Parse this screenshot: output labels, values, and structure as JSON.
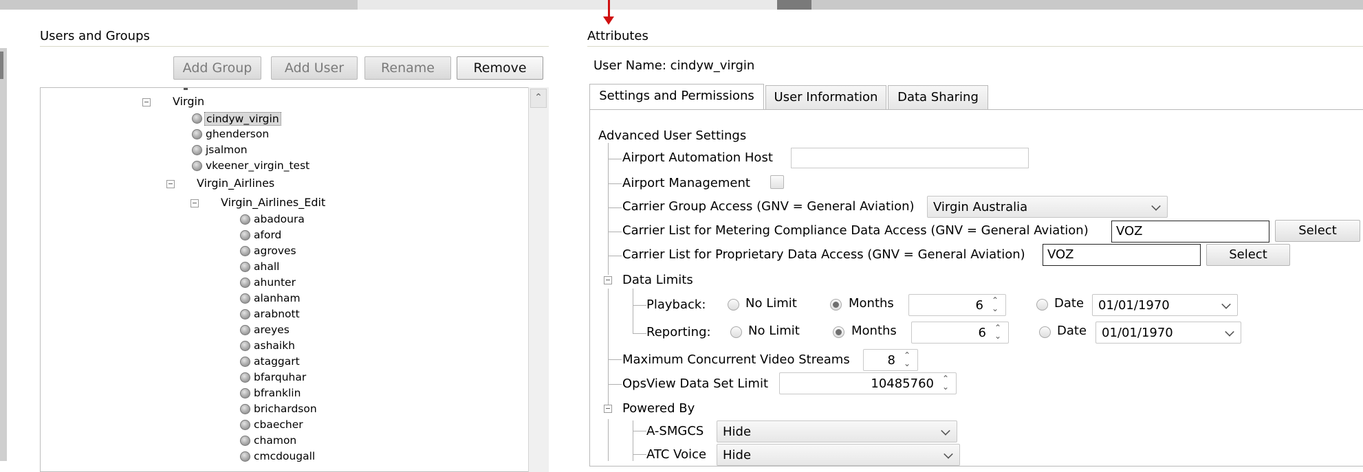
{
  "left_panel": {
    "title": "Users and Groups",
    "buttons": {
      "add_group": "Add Group",
      "add_user": "Add User",
      "rename": "Rename",
      "remove": "Remove"
    },
    "tree": {
      "group_virgin": "Virgin",
      "virgin_users": [
        "cindyw_virgin",
        "ghenderson",
        "jsalmon",
        "vkeener_virgin_test"
      ],
      "group_virgin_airlines": "Virgin_Airlines",
      "group_virgin_airlines_edit": "Virgin_Airlines_Edit",
      "edit_users": [
        "abadoura",
        "aford",
        "agroves",
        "ahall",
        "ahunter",
        "alanham",
        "arabnott",
        "areyes",
        "ashaikh",
        "ataggart",
        "bfarquhar",
        "bfranklin",
        "brichardson",
        "cbaecher",
        "chamon",
        "cmcdougall"
      ]
    }
  },
  "right_panel": {
    "title": "Attributes",
    "user_name": "User Name: cindyw_virgin",
    "tabs": [
      "Settings and Permissions",
      "User Information",
      "Data Sharing"
    ],
    "section_advanced": "Advanced User Settings",
    "airport_host_label": "Airport Automation Host",
    "airport_host_value": "",
    "airport_mgmt_label": "Airport Management",
    "carrier_group_label": "Carrier Group Access (GNV = General Aviation)",
    "carrier_group_value": "Virgin Australia",
    "metering_label": "Carrier List for Metering Compliance Data Access (GNV = General Aviation)",
    "metering_value": "VOZ",
    "proprietary_label": "Carrier List for Proprietary Data Access (GNV = General Aviation)",
    "proprietary_value": "VOZ",
    "select_label": "Select",
    "data_limits_label": "Data Limits",
    "playback_label": "Playback:",
    "reporting_label": "Reporting:",
    "no_limit": "No Limit",
    "months": "Months",
    "date": "Date",
    "playback_months": "6",
    "reporting_months": "6",
    "playback_date": "01/01/1970",
    "reporting_date": "01/01/1970",
    "max_video_label": "Maximum Concurrent Video Streams",
    "max_video_value": "8",
    "opsview_label": "OpsView Data Set Limit",
    "opsview_value": "10485760",
    "powered_by_label": "Powered By",
    "asmgcs_label": "A-SMGCS",
    "asmgcs_value": "Hide",
    "atc_voice_label": "ATC Voice",
    "atc_voice_value": "Hide"
  }
}
